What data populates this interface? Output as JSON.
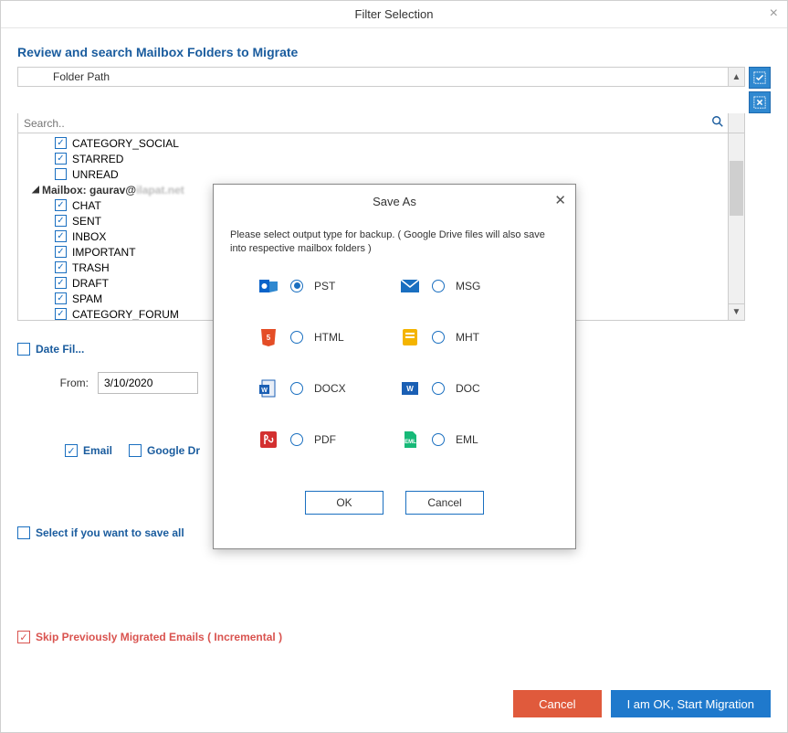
{
  "window": {
    "title": "Filter Selection"
  },
  "heading": "Review and search Mailbox Folders to Migrate",
  "folder_path_label": "Folder Path",
  "search": {
    "placeholder": "Search.."
  },
  "tree": [
    {
      "type": "item",
      "checked": true,
      "label": "CATEGORY_SOCIAL"
    },
    {
      "type": "item",
      "checked": true,
      "label": "STARRED"
    },
    {
      "type": "item",
      "checked": false,
      "label": "UNREAD"
    },
    {
      "type": "mailbox",
      "label": "Mailbox: gaurav@"
    },
    {
      "type": "item",
      "checked": true,
      "label": "CHAT"
    },
    {
      "type": "item",
      "checked": true,
      "label": "SENT"
    },
    {
      "type": "item",
      "checked": true,
      "label": "INBOX"
    },
    {
      "type": "item",
      "checked": true,
      "label": "IMPORTANT"
    },
    {
      "type": "item",
      "checked": true,
      "label": "TRASH"
    },
    {
      "type": "item",
      "checked": true,
      "label": "DRAFT"
    },
    {
      "type": "item",
      "checked": true,
      "label": "SPAM"
    },
    {
      "type": "item",
      "checked": true,
      "label": "CATEGORY_FORUM"
    }
  ],
  "date_filter": {
    "checkbox_label": "Date Fil...",
    "from_label": "From:",
    "from_value": "3/10/2020"
  },
  "services": {
    "email_label": "Email",
    "gdrive_label": "Google Dr"
  },
  "select_save_all_label": "Select if you want to save all ",
  "skip_label": "Skip Previously Migrated Emails ( Incremental )",
  "buttons": {
    "cancel": "Cancel",
    "start": "I am OK, Start Migration"
  },
  "modal": {
    "title": "Save As",
    "message": "Please select output type for backup. ( Google Drive files will also save into respective mailbox folders )",
    "formats": {
      "pst": "PST",
      "msg": "MSG",
      "html": "HTML",
      "mht": "MHT",
      "docx": "DOCX",
      "doc": "DOC",
      "pdf": "PDF",
      "eml": "EML"
    },
    "selected": "pst",
    "ok": "OK",
    "cancel": "Cancel"
  }
}
